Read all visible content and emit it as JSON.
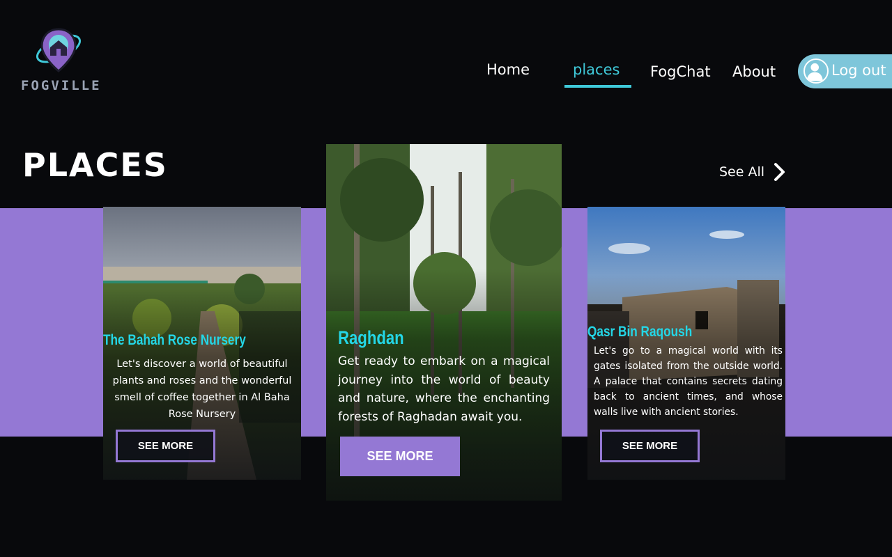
{
  "logo": {
    "text": "FOGVILLE",
    "icon": "fogville-logo-icon"
  },
  "nav": {
    "home": "Home",
    "places": "places",
    "fogchat": "FogChat",
    "about": "About",
    "logout": "Log out",
    "active": "places"
  },
  "section": {
    "title": "PLACES",
    "see_all": "See All"
  },
  "cards": [
    {
      "title": "The Bahah Rose Nursery",
      "description": "Let's discover a world of beautiful plants and roses and the wonderful smell of coffee together in Al Baha Rose Nursery",
      "button": "SEE MORE"
    },
    {
      "title": "Raghdan",
      "description": "Get ready to embark on a magical journey into the world of beauty and nature, where the enchanting forests of Raghadan await you.",
      "button": "SEE MORE"
    },
    {
      "title": "Qasr Bin Raqoush",
      "description": "Let's go to a magical world with its gates isolated from the outside world. A palace that contains secrets dating back to ancient times, and whose walls live with ancient stories.",
      "button": "SEE MORE"
    }
  ],
  "colors": {
    "background": "#08090c",
    "accent_cyan": "#3fc9d9",
    "accent_purple": "#9478d4",
    "logout_bg": "#7ec6da"
  }
}
